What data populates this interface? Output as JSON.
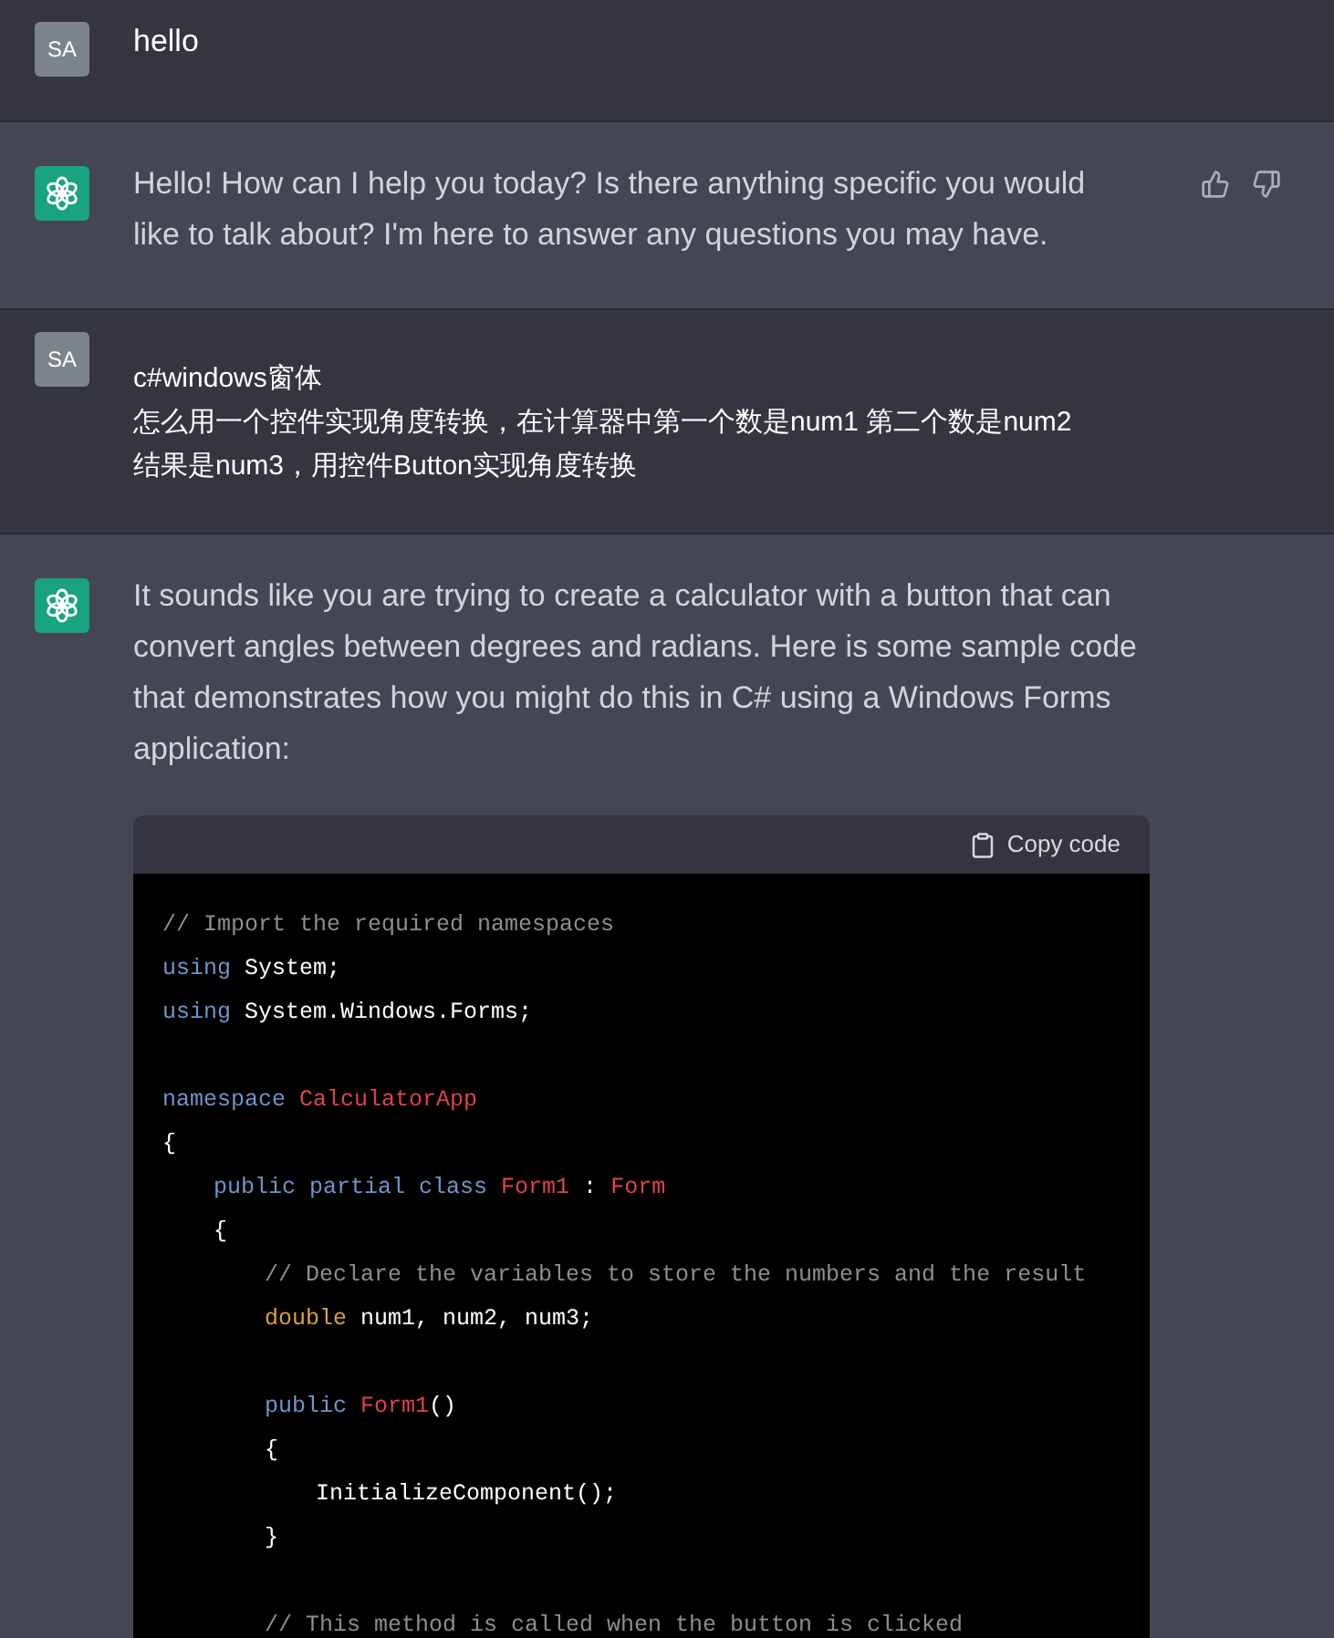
{
  "messages": [
    {
      "kind": "user",
      "avatar": "SA",
      "lines": [
        "hello"
      ]
    },
    {
      "kind": "assistant",
      "feedback_buttons": true,
      "paragraphs": [
        "Hello! How can I help you today? Is there anything specific you would like to talk about? I'm here to answer any questions you may have."
      ]
    },
    {
      "kind": "user",
      "avatar": "SA",
      "lines": [
        "c#windows窗体",
        "怎么用一个控件实现角度转换，在计算器中第一个数是num1 第二个数是num2",
        "结果是num3，用控件Button实现角度转换"
      ]
    },
    {
      "kind": "assistant",
      "feedback_buttons": false,
      "paragraphs": [
        "It sounds like you are trying to create a calculator with a button that can convert angles between degrees and radians. Here is some sample code that demonstrates how you might do this in C# using a Windows Forms application:"
      ],
      "code": {
        "copy_label": "Copy code",
        "lines": [
          {
            "kind": "code",
            "tokens": [
              {
                "kind": "comment",
                "text": "// Import the required namespaces"
              }
            ]
          },
          {
            "kind": "code",
            "tokens": [
              {
                "kind": "keyword",
                "text": "using"
              },
              {
                "kind": "plain",
                "text": " System;"
              }
            ]
          },
          {
            "kind": "code",
            "tokens": [
              {
                "kind": "keyword",
                "text": "using"
              },
              {
                "kind": "plain",
                "text": " System.Windows.Forms;"
              }
            ]
          },
          {
            "kind": "blank"
          },
          {
            "kind": "code",
            "tokens": [
              {
                "kind": "keyword",
                "text": "namespace "
              },
              {
                "kind": "type",
                "text": "CalculatorApp"
              }
            ]
          },
          {
            "kind": "code",
            "tokens": [
              {
                "kind": "plain",
                "text": "{"
              }
            ],
            "children": [
              {
                "kind": "code",
                "tokens": [
                  {
                    "kind": "keyword",
                    "text": "public partial class "
                  },
                  {
                    "kind": "type",
                    "text": "Form1"
                  },
                  {
                    "kind": "plain",
                    "text": " : "
                  },
                  {
                    "kind": "type",
                    "text": "Form"
                  }
                ]
              },
              {
                "kind": "code",
                "tokens": [
                  {
                    "kind": "plain",
                    "text": "{"
                  }
                ],
                "children": [
                  {
                    "kind": "code",
                    "tokens": [
                      {
                        "kind": "comment",
                        "text": "// Declare the variables to store the numbers and the result"
                      }
                    ]
                  },
                  {
                    "kind": "code",
                    "tokens": [
                      {
                        "kind": "builtin",
                        "text": "double"
                      },
                      {
                        "kind": "plain",
                        "text": " num1, num2, num3;"
                      }
                    ]
                  },
                  {
                    "kind": "blank"
                  },
                  {
                    "kind": "code",
                    "tokens": [
                      {
                        "kind": "keyword",
                        "text": "public "
                      },
                      {
                        "kind": "type",
                        "text": "Form1"
                      },
                      {
                        "kind": "plain",
                        "text": "()"
                      }
                    ]
                  },
                  {
                    "kind": "code",
                    "tokens": [
                      {
                        "kind": "plain",
                        "text": "{"
                      }
                    ],
                    "children": [
                      {
                        "kind": "code",
                        "tokens": [
                          {
                            "kind": "plain",
                            "text": "InitializeComponent();"
                          }
                        ]
                      }
                    ]
                  },
                  {
                    "kind": "code",
                    "tokens": [
                      {
                        "kind": "plain",
                        "text": "}"
                      }
                    ]
                  },
                  {
                    "kind": "blank"
                  },
                  {
                    "kind": "code",
                    "tokens": [
                      {
                        "kind": "comment",
                        "text": "// This method is called when the button is clicked"
                      }
                    ]
                  }
                ]
              }
            ]
          }
        ]
      }
    }
  ]
}
